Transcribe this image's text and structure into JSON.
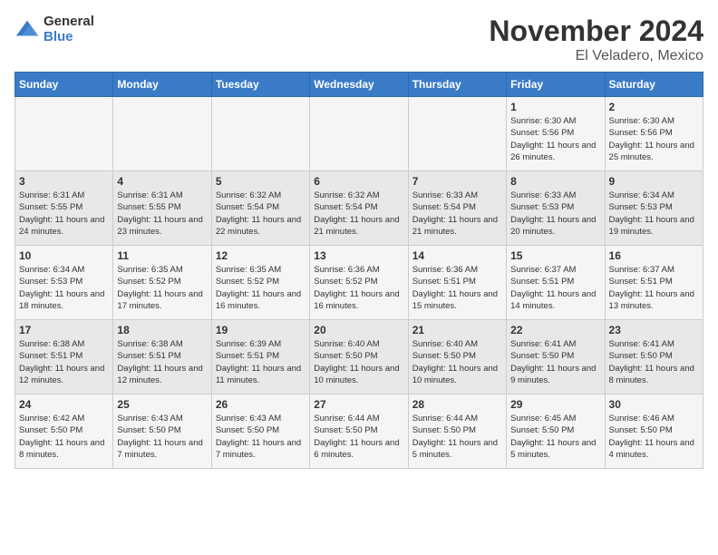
{
  "logo": {
    "general": "General",
    "blue": "Blue"
  },
  "title": "November 2024",
  "location": "El Veladero, Mexico",
  "days_of_week": [
    "Sunday",
    "Monday",
    "Tuesday",
    "Wednesday",
    "Thursday",
    "Friday",
    "Saturday"
  ],
  "weeks": [
    [
      {
        "day": "",
        "info": ""
      },
      {
        "day": "",
        "info": ""
      },
      {
        "day": "",
        "info": ""
      },
      {
        "day": "",
        "info": ""
      },
      {
        "day": "",
        "info": ""
      },
      {
        "day": "1",
        "info": "Sunrise: 6:30 AM\nSunset: 5:56 PM\nDaylight: 11 hours and 26 minutes."
      },
      {
        "day": "2",
        "info": "Sunrise: 6:30 AM\nSunset: 5:56 PM\nDaylight: 11 hours and 25 minutes."
      }
    ],
    [
      {
        "day": "3",
        "info": "Sunrise: 6:31 AM\nSunset: 5:55 PM\nDaylight: 11 hours and 24 minutes."
      },
      {
        "day": "4",
        "info": "Sunrise: 6:31 AM\nSunset: 5:55 PM\nDaylight: 11 hours and 23 minutes."
      },
      {
        "day": "5",
        "info": "Sunrise: 6:32 AM\nSunset: 5:54 PM\nDaylight: 11 hours and 22 minutes."
      },
      {
        "day": "6",
        "info": "Sunrise: 6:32 AM\nSunset: 5:54 PM\nDaylight: 11 hours and 21 minutes."
      },
      {
        "day": "7",
        "info": "Sunrise: 6:33 AM\nSunset: 5:54 PM\nDaylight: 11 hours and 21 minutes."
      },
      {
        "day": "8",
        "info": "Sunrise: 6:33 AM\nSunset: 5:53 PM\nDaylight: 11 hours and 20 minutes."
      },
      {
        "day": "9",
        "info": "Sunrise: 6:34 AM\nSunset: 5:53 PM\nDaylight: 11 hours and 19 minutes."
      }
    ],
    [
      {
        "day": "10",
        "info": "Sunrise: 6:34 AM\nSunset: 5:53 PM\nDaylight: 11 hours and 18 minutes."
      },
      {
        "day": "11",
        "info": "Sunrise: 6:35 AM\nSunset: 5:52 PM\nDaylight: 11 hours and 17 minutes."
      },
      {
        "day": "12",
        "info": "Sunrise: 6:35 AM\nSunset: 5:52 PM\nDaylight: 11 hours and 16 minutes."
      },
      {
        "day": "13",
        "info": "Sunrise: 6:36 AM\nSunset: 5:52 PM\nDaylight: 11 hours and 16 minutes."
      },
      {
        "day": "14",
        "info": "Sunrise: 6:36 AM\nSunset: 5:51 PM\nDaylight: 11 hours and 15 minutes."
      },
      {
        "day": "15",
        "info": "Sunrise: 6:37 AM\nSunset: 5:51 PM\nDaylight: 11 hours and 14 minutes."
      },
      {
        "day": "16",
        "info": "Sunrise: 6:37 AM\nSunset: 5:51 PM\nDaylight: 11 hours and 13 minutes."
      }
    ],
    [
      {
        "day": "17",
        "info": "Sunrise: 6:38 AM\nSunset: 5:51 PM\nDaylight: 11 hours and 12 minutes."
      },
      {
        "day": "18",
        "info": "Sunrise: 6:38 AM\nSunset: 5:51 PM\nDaylight: 11 hours and 12 minutes."
      },
      {
        "day": "19",
        "info": "Sunrise: 6:39 AM\nSunset: 5:51 PM\nDaylight: 11 hours and 11 minutes."
      },
      {
        "day": "20",
        "info": "Sunrise: 6:40 AM\nSunset: 5:50 PM\nDaylight: 11 hours and 10 minutes."
      },
      {
        "day": "21",
        "info": "Sunrise: 6:40 AM\nSunset: 5:50 PM\nDaylight: 11 hours and 10 minutes."
      },
      {
        "day": "22",
        "info": "Sunrise: 6:41 AM\nSunset: 5:50 PM\nDaylight: 11 hours and 9 minutes."
      },
      {
        "day": "23",
        "info": "Sunrise: 6:41 AM\nSunset: 5:50 PM\nDaylight: 11 hours and 8 minutes."
      }
    ],
    [
      {
        "day": "24",
        "info": "Sunrise: 6:42 AM\nSunset: 5:50 PM\nDaylight: 11 hours and 8 minutes."
      },
      {
        "day": "25",
        "info": "Sunrise: 6:43 AM\nSunset: 5:50 PM\nDaylight: 11 hours and 7 minutes."
      },
      {
        "day": "26",
        "info": "Sunrise: 6:43 AM\nSunset: 5:50 PM\nDaylight: 11 hours and 7 minutes."
      },
      {
        "day": "27",
        "info": "Sunrise: 6:44 AM\nSunset: 5:50 PM\nDaylight: 11 hours and 6 minutes."
      },
      {
        "day": "28",
        "info": "Sunrise: 6:44 AM\nSunset: 5:50 PM\nDaylight: 11 hours and 5 minutes."
      },
      {
        "day": "29",
        "info": "Sunrise: 6:45 AM\nSunset: 5:50 PM\nDaylight: 11 hours and 5 minutes."
      },
      {
        "day": "30",
        "info": "Sunrise: 6:46 AM\nSunset: 5:50 PM\nDaylight: 11 hours and 4 minutes."
      }
    ]
  ]
}
